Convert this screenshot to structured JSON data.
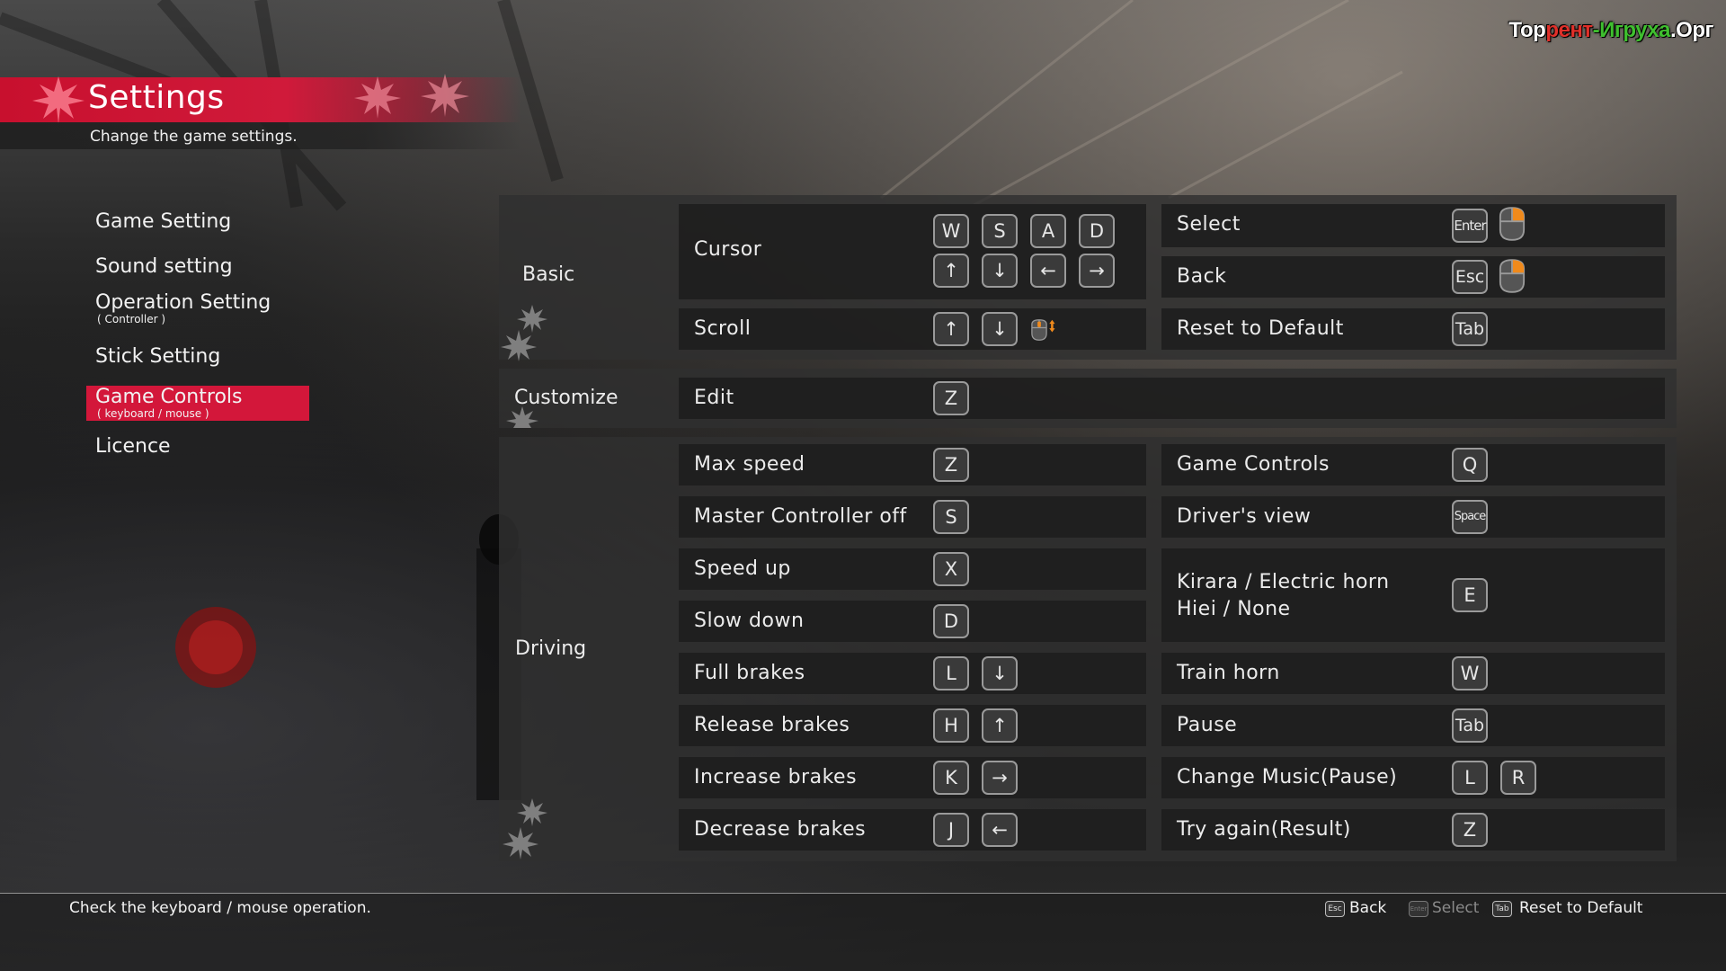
{
  "watermark": {
    "part1": "Тор",
    "part2": "рент",
    "part3": "-Игруха",
    "part4": ".Орг"
  },
  "header": {
    "title": "Settings",
    "subtitle": "Change the game settings."
  },
  "menu": [
    {
      "label": "Game Setting",
      "sub": ""
    },
    {
      "label": "Sound setting",
      "sub": ""
    },
    {
      "label": "Operation Setting",
      "sub": "( Controller )"
    },
    {
      "label": "Stick Setting",
      "sub": ""
    },
    {
      "label": "Game Controls",
      "sub": "( keyboard / mouse )",
      "active": true
    },
    {
      "label": "Licence",
      "sub": ""
    }
  ],
  "sections": {
    "basic": "Basic",
    "customize": "Customize",
    "driving": "Driving"
  },
  "basic": {
    "cursor": {
      "label": "Cursor",
      "keys_row1": [
        "W",
        "S",
        "A",
        "D"
      ],
      "keys_row2": [
        "↑",
        "↓",
        "←",
        "→"
      ]
    },
    "scroll": {
      "label": "Scroll",
      "keys": [
        "↑",
        "↓"
      ],
      "icon": "mouse-wheel-icon"
    },
    "select": {
      "label": "Select",
      "key": "Enter",
      "icon": "mouse-left-click-icon"
    },
    "back": {
      "label": "Back",
      "key": "Esc",
      "icon": "mouse-right-click-icon"
    },
    "reset": {
      "label": "Reset to Default",
      "key": "Tab"
    }
  },
  "customize": {
    "edit": {
      "label": "Edit",
      "key": "Z"
    }
  },
  "driving_left": [
    {
      "label": "Max speed",
      "keys": [
        "Z"
      ]
    },
    {
      "label": "Master Controller off",
      "keys": [
        "S"
      ]
    },
    {
      "label": "Speed up",
      "keys": [
        "X"
      ]
    },
    {
      "label": "Slow down",
      "keys": [
        "D"
      ]
    },
    {
      "label": "Full brakes",
      "keys": [
        "L",
        "↓"
      ]
    },
    {
      "label": "Release brakes",
      "keys": [
        "H",
        "↑"
      ]
    },
    {
      "label": "Increase brakes",
      "keys": [
        "K",
        "→"
      ]
    },
    {
      "label": "Decrease brakes",
      "keys": [
        "J",
        "←"
      ]
    }
  ],
  "driving_right": [
    {
      "label": "Game Controls",
      "keys": [
        "Q"
      ]
    },
    {
      "label": "Driver's view",
      "keys": [
        "Space"
      ]
    },
    {
      "label": "Kirara / Electric horn",
      "label2": "Hiei / None",
      "keys": [
        "E"
      ]
    },
    {
      "label": "Train horn",
      "keys": [
        "W"
      ]
    },
    {
      "label": "Pause",
      "keys": [
        "Tab"
      ]
    },
    {
      "label": "Change Music(Pause)",
      "keys": [
        "L",
        "R"
      ]
    },
    {
      "label": "Try again(Result)",
      "keys": [
        "Z"
      ]
    }
  ],
  "footer": {
    "hint": "Check the keyboard / mouse operation.",
    "back_key": "Esc",
    "back_label": "Back",
    "select_key": "Enter",
    "select_label": "Select",
    "reset_key": "Tab",
    "reset_label": "Reset to Default"
  },
  "colors": {
    "accent": "#d3173a",
    "mouse_highlight": "#f08a1c"
  }
}
